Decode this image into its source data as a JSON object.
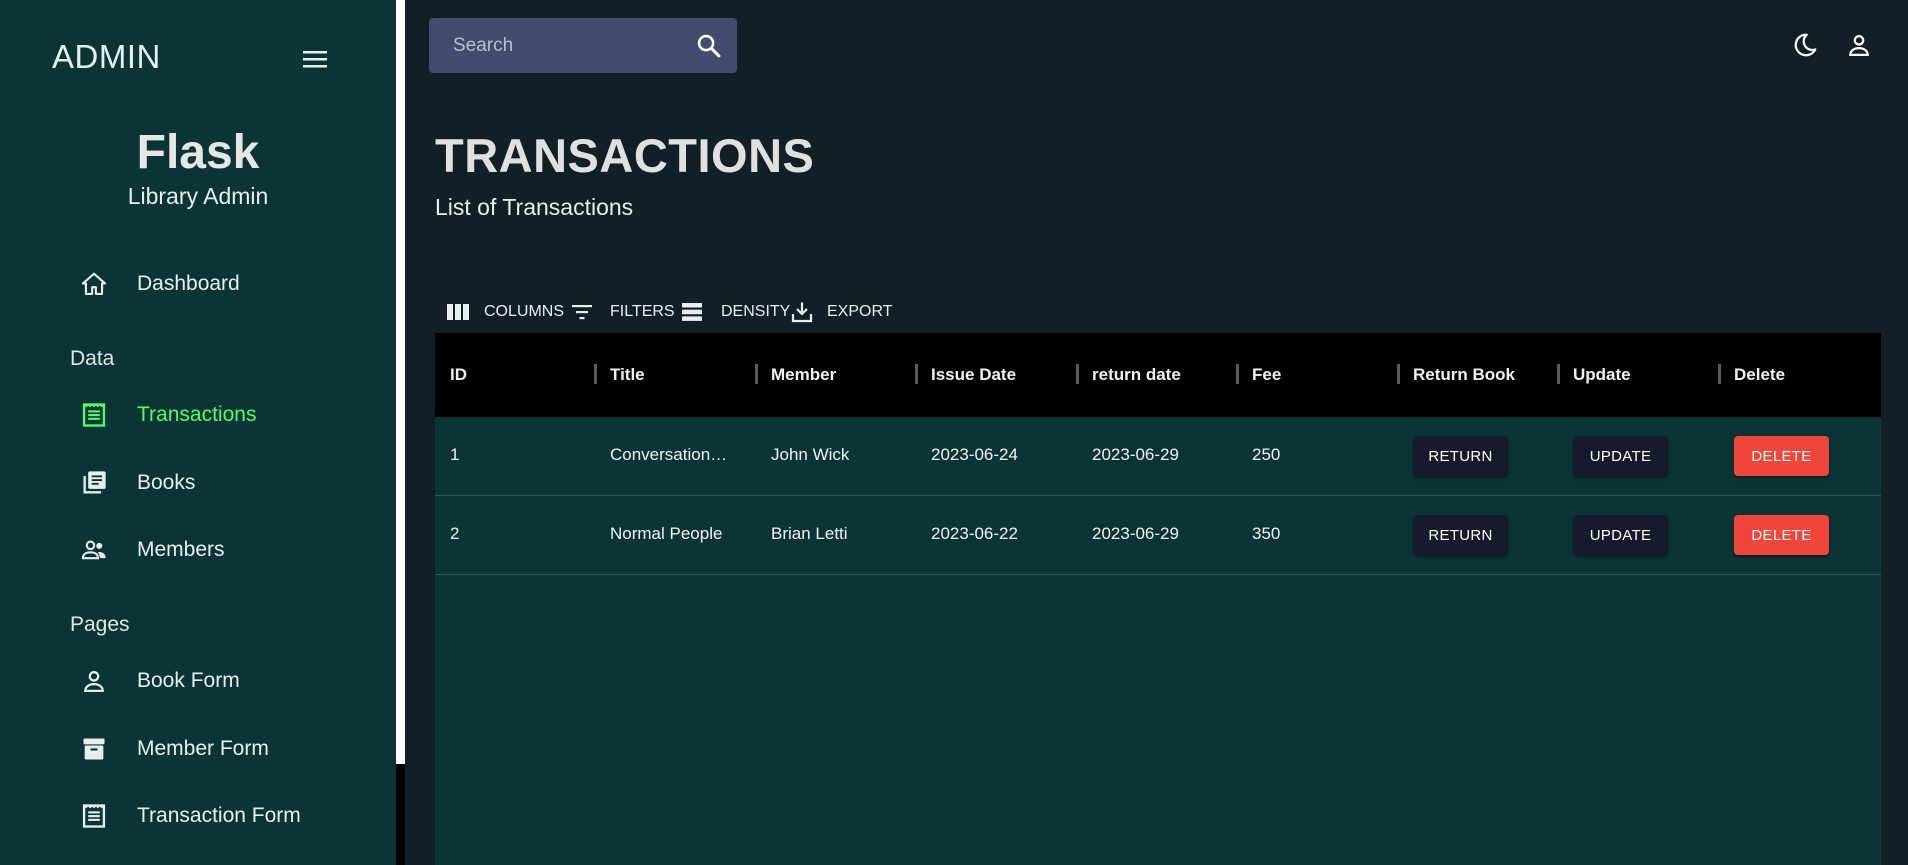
{
  "sidebar": {
    "brand": "ADMIN",
    "profile": {
      "name": "Flask",
      "role": "Library Admin"
    },
    "sections": [
      {
        "label": "Data"
      },
      {
        "label": "Pages"
      }
    ],
    "items": [
      {
        "label": "Dashboard",
        "icon": "home-icon"
      },
      {
        "label": "Transactions",
        "icon": "receipt-icon",
        "active": true
      },
      {
        "label": "Books",
        "icon": "library-books-icon"
      },
      {
        "label": "Members",
        "icon": "people-icon"
      },
      {
        "label": "Book Form",
        "icon": "person-icon"
      },
      {
        "label": "Member Form",
        "icon": "archive-icon"
      },
      {
        "label": "Transaction Form",
        "icon": "receipt-icon"
      }
    ]
  },
  "topbar": {
    "search": {
      "placeholder": "Search",
      "value": ""
    }
  },
  "header": {
    "title": "TRANSACTIONS",
    "subtitle": "List of Transactions"
  },
  "toolbar": {
    "columns": "COLUMNS",
    "filters": "FILTERS",
    "density": "DENSITY",
    "export": "EXPORT"
  },
  "table": {
    "columns": [
      "ID",
      "Title",
      "Member",
      "Issue Date",
      "return date",
      "Fee",
      "Return Book",
      "Update",
      "Delete"
    ],
    "rows": [
      {
        "id": "1",
        "title": "Conversations with Friends",
        "member": "John Wick",
        "issue_date": "2023-06-24",
        "return_date": "2023-06-29",
        "fee": "250",
        "return_label": "RETURN",
        "update_label": "UPDATE",
        "delete_label": "DELETE"
      },
      {
        "id": "2",
        "title": "Normal People",
        "member": "Brian Letti",
        "issue_date": "2023-06-22",
        "return_date": "2023-06-29",
        "fee": "350",
        "return_label": "RETURN",
        "update_label": "UPDATE",
        "delete_label": "DELETE"
      }
    ]
  },
  "colors": {
    "sidebar_bg": "#0b3535",
    "main_bg": "#111f27",
    "accent_active": "#4cff6b",
    "delete_button": "#f0453a",
    "dark_button": "#161a2c",
    "table_header": "#000000",
    "search_bg": "#424c6c"
  }
}
